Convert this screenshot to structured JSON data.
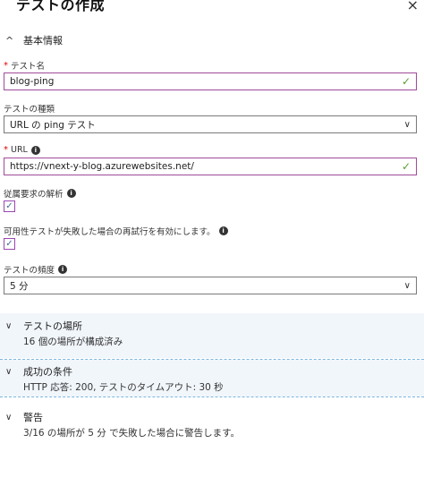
{
  "header": {
    "title": "テストの作成",
    "close_glyph": "×"
  },
  "basic": {
    "section_title": "基本情報",
    "chevron": "^"
  },
  "test_name": {
    "label": "テスト名",
    "value": "blog-ping",
    "required": "*"
  },
  "test_type": {
    "label": "テストの種類",
    "value": "URL の ping テスト"
  },
  "url": {
    "label": "URL",
    "value": "https://vnext-y-blog.azurewebsites.net/",
    "required": "*"
  },
  "dependent": {
    "label": "従属要求の解析",
    "checked": true
  },
  "retry": {
    "label": "可用性テストが失敗した場合の再試行を有効にします。",
    "checked": true
  },
  "frequency": {
    "label": "テストの頻度",
    "value": "5 分"
  },
  "locations": {
    "title": "テストの場所",
    "summary": "16 個の場所が構成済み"
  },
  "success": {
    "title": "成功の条件",
    "summary": "HTTP 応答: 200, テストのタイムアウト: 30 秒"
  },
  "alerts": {
    "title": "警告",
    "summary": "3/16 の場所が 5 分 で失敗した場合に警告します。"
  },
  "glyphs": {
    "check": "✓",
    "down": "∨",
    "info": "i",
    "box_check": "✓"
  }
}
